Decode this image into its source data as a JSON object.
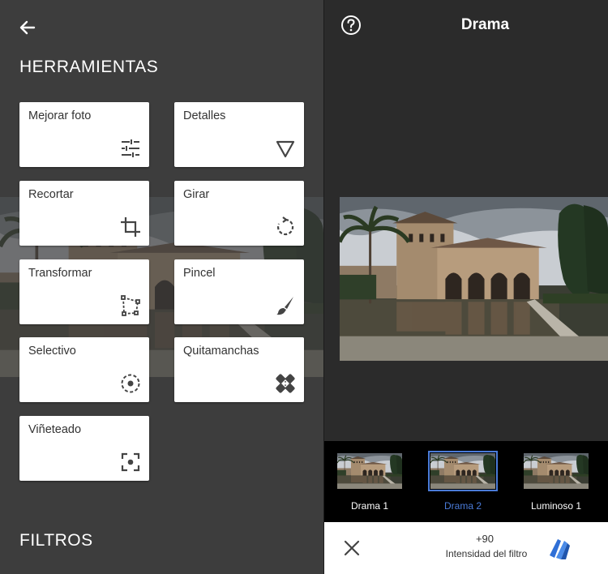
{
  "left_panel": {
    "section_tools": "HERRAMIENTAS",
    "section_filters": "FILTROS",
    "tools": [
      {
        "label": "Mejorar foto",
        "icon": "tune-icon"
      },
      {
        "label": "Detalles",
        "icon": "details-triangle-icon"
      },
      {
        "label": "Recortar",
        "icon": "crop-icon"
      },
      {
        "label": "Girar",
        "icon": "rotate-icon"
      },
      {
        "label": "Transformar",
        "icon": "transform-icon"
      },
      {
        "label": "Pincel",
        "icon": "brush-icon"
      },
      {
        "label": "Selectivo",
        "icon": "selective-icon"
      },
      {
        "label": "Quitamanchas",
        "icon": "healing-icon"
      },
      {
        "label": "Viñeteado",
        "icon": "vignette-icon"
      }
    ]
  },
  "right_panel": {
    "title": "Drama",
    "filters": [
      {
        "label": "Drama 1",
        "selected": false
      },
      {
        "label": "Drama 2",
        "selected": true
      },
      {
        "label": "Luminoso 1",
        "selected": false
      }
    ],
    "filter_value": "+90",
    "filter_caption": "Intensidad del filtro"
  },
  "colors": {
    "accent": "#4a7bd8",
    "panel": "#3d3d3d",
    "background": "#2b2b2b"
  }
}
